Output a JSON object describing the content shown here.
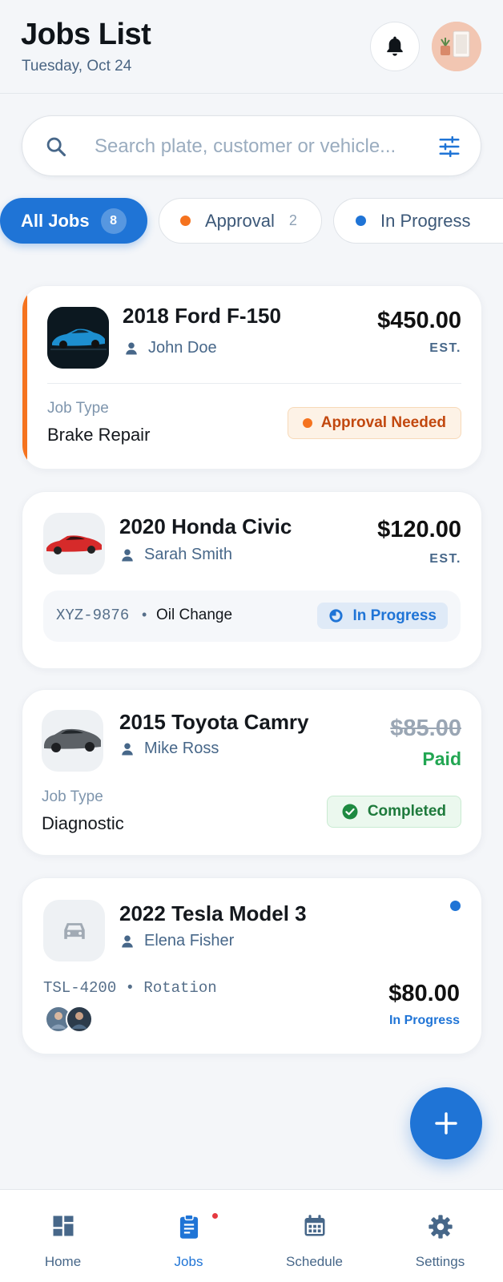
{
  "header": {
    "title": "Jobs List",
    "date": "Tuesday, Oct 24"
  },
  "search": {
    "placeholder": "Search plate, customer or vehicle..."
  },
  "filters": [
    {
      "label": "All Jobs",
      "count": "8",
      "active": true
    },
    {
      "label": "Approval",
      "count": "2",
      "dot_color": "#f5731f"
    },
    {
      "label": "In Progress",
      "dot_color": "#1f74d6"
    }
  ],
  "jobs": [
    {
      "vehicle": "2018 Ford F-150",
      "customer": "John Doe",
      "price": "$450.00",
      "price_note": "EST.",
      "job_type_label": "Job Type",
      "job_type": "Brake Repair",
      "status": "Approval Needed",
      "accent_color": "#f5731f"
    },
    {
      "vehicle": "2020 Honda Civic",
      "customer": "Sarah Smith",
      "price": "$120.00",
      "price_note": "EST.",
      "plate": "XYZ-9876",
      "separator": "•",
      "job_type": "Oil Change",
      "status": "In Progress"
    },
    {
      "vehicle": "2015 Toyota Camry",
      "customer": "Mike Ross",
      "price": "$85.00",
      "price_note": "Paid",
      "job_type_label": "Job Type",
      "job_type": "Diagnostic",
      "status": "Completed"
    },
    {
      "vehicle": "2022 Tesla Model 3",
      "customer": "Elena Fisher",
      "plate_line": "TSL-4200 • Rotation",
      "price": "$80.00",
      "status": "In Progress"
    }
  ],
  "nav": [
    {
      "label": "Home",
      "icon": "dashboard-icon"
    },
    {
      "label": "Jobs",
      "icon": "clipboard-icon",
      "active": true
    },
    {
      "label": "Schedule",
      "icon": "calendar-icon"
    },
    {
      "label": "Settings",
      "icon": "gear-icon"
    }
  ],
  "colors": {
    "primary": "#1f74d6",
    "approval": "#f5731f",
    "success": "#22a652",
    "background": "#f4f6f9"
  }
}
